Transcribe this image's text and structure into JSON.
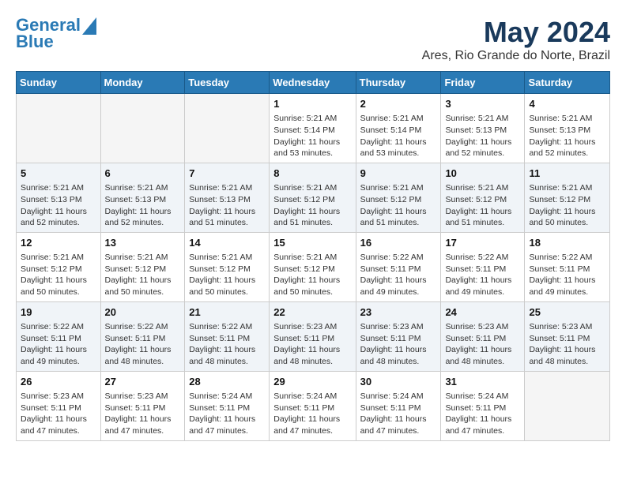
{
  "header": {
    "logo_line1": "General",
    "logo_line2": "Blue",
    "month": "May 2024",
    "location": "Ares, Rio Grande do Norte, Brazil"
  },
  "days_of_week": [
    "Sunday",
    "Monday",
    "Tuesday",
    "Wednesday",
    "Thursday",
    "Friday",
    "Saturday"
  ],
  "weeks": [
    [
      {
        "day": "",
        "info": ""
      },
      {
        "day": "",
        "info": ""
      },
      {
        "day": "",
        "info": ""
      },
      {
        "day": "1",
        "info": "Sunrise: 5:21 AM\nSunset: 5:14 PM\nDaylight: 11 hours\nand 53 minutes."
      },
      {
        "day": "2",
        "info": "Sunrise: 5:21 AM\nSunset: 5:14 PM\nDaylight: 11 hours\nand 53 minutes."
      },
      {
        "day": "3",
        "info": "Sunrise: 5:21 AM\nSunset: 5:13 PM\nDaylight: 11 hours\nand 52 minutes."
      },
      {
        "day": "4",
        "info": "Sunrise: 5:21 AM\nSunset: 5:13 PM\nDaylight: 11 hours\nand 52 minutes."
      }
    ],
    [
      {
        "day": "5",
        "info": "Sunrise: 5:21 AM\nSunset: 5:13 PM\nDaylight: 11 hours\nand 52 minutes."
      },
      {
        "day": "6",
        "info": "Sunrise: 5:21 AM\nSunset: 5:13 PM\nDaylight: 11 hours\nand 52 minutes."
      },
      {
        "day": "7",
        "info": "Sunrise: 5:21 AM\nSunset: 5:13 PM\nDaylight: 11 hours\nand 51 minutes."
      },
      {
        "day": "8",
        "info": "Sunrise: 5:21 AM\nSunset: 5:12 PM\nDaylight: 11 hours\nand 51 minutes."
      },
      {
        "day": "9",
        "info": "Sunrise: 5:21 AM\nSunset: 5:12 PM\nDaylight: 11 hours\nand 51 minutes."
      },
      {
        "day": "10",
        "info": "Sunrise: 5:21 AM\nSunset: 5:12 PM\nDaylight: 11 hours\nand 51 minutes."
      },
      {
        "day": "11",
        "info": "Sunrise: 5:21 AM\nSunset: 5:12 PM\nDaylight: 11 hours\nand 50 minutes."
      }
    ],
    [
      {
        "day": "12",
        "info": "Sunrise: 5:21 AM\nSunset: 5:12 PM\nDaylight: 11 hours\nand 50 minutes."
      },
      {
        "day": "13",
        "info": "Sunrise: 5:21 AM\nSunset: 5:12 PM\nDaylight: 11 hours\nand 50 minutes."
      },
      {
        "day": "14",
        "info": "Sunrise: 5:21 AM\nSunset: 5:12 PM\nDaylight: 11 hours\nand 50 minutes."
      },
      {
        "day": "15",
        "info": "Sunrise: 5:21 AM\nSunset: 5:12 PM\nDaylight: 11 hours\nand 50 minutes."
      },
      {
        "day": "16",
        "info": "Sunrise: 5:22 AM\nSunset: 5:11 PM\nDaylight: 11 hours\nand 49 minutes."
      },
      {
        "day": "17",
        "info": "Sunrise: 5:22 AM\nSunset: 5:11 PM\nDaylight: 11 hours\nand 49 minutes."
      },
      {
        "day": "18",
        "info": "Sunrise: 5:22 AM\nSunset: 5:11 PM\nDaylight: 11 hours\nand 49 minutes."
      }
    ],
    [
      {
        "day": "19",
        "info": "Sunrise: 5:22 AM\nSunset: 5:11 PM\nDaylight: 11 hours\nand 49 minutes."
      },
      {
        "day": "20",
        "info": "Sunrise: 5:22 AM\nSunset: 5:11 PM\nDaylight: 11 hours\nand 48 minutes."
      },
      {
        "day": "21",
        "info": "Sunrise: 5:22 AM\nSunset: 5:11 PM\nDaylight: 11 hours\nand 48 minutes."
      },
      {
        "day": "22",
        "info": "Sunrise: 5:23 AM\nSunset: 5:11 PM\nDaylight: 11 hours\nand 48 minutes."
      },
      {
        "day": "23",
        "info": "Sunrise: 5:23 AM\nSunset: 5:11 PM\nDaylight: 11 hours\nand 48 minutes."
      },
      {
        "day": "24",
        "info": "Sunrise: 5:23 AM\nSunset: 5:11 PM\nDaylight: 11 hours\nand 48 minutes."
      },
      {
        "day": "25",
        "info": "Sunrise: 5:23 AM\nSunset: 5:11 PM\nDaylight: 11 hours\nand 48 minutes."
      }
    ],
    [
      {
        "day": "26",
        "info": "Sunrise: 5:23 AM\nSunset: 5:11 PM\nDaylight: 11 hours\nand 47 minutes."
      },
      {
        "day": "27",
        "info": "Sunrise: 5:23 AM\nSunset: 5:11 PM\nDaylight: 11 hours\nand 47 minutes."
      },
      {
        "day": "28",
        "info": "Sunrise: 5:24 AM\nSunset: 5:11 PM\nDaylight: 11 hours\nand 47 minutes."
      },
      {
        "day": "29",
        "info": "Sunrise: 5:24 AM\nSunset: 5:11 PM\nDaylight: 11 hours\nand 47 minutes."
      },
      {
        "day": "30",
        "info": "Sunrise: 5:24 AM\nSunset: 5:11 PM\nDaylight: 11 hours\nand 47 minutes."
      },
      {
        "day": "31",
        "info": "Sunrise: 5:24 AM\nSunset: 5:11 PM\nDaylight: 11 hours\nand 47 minutes."
      },
      {
        "day": "",
        "info": ""
      }
    ]
  ]
}
